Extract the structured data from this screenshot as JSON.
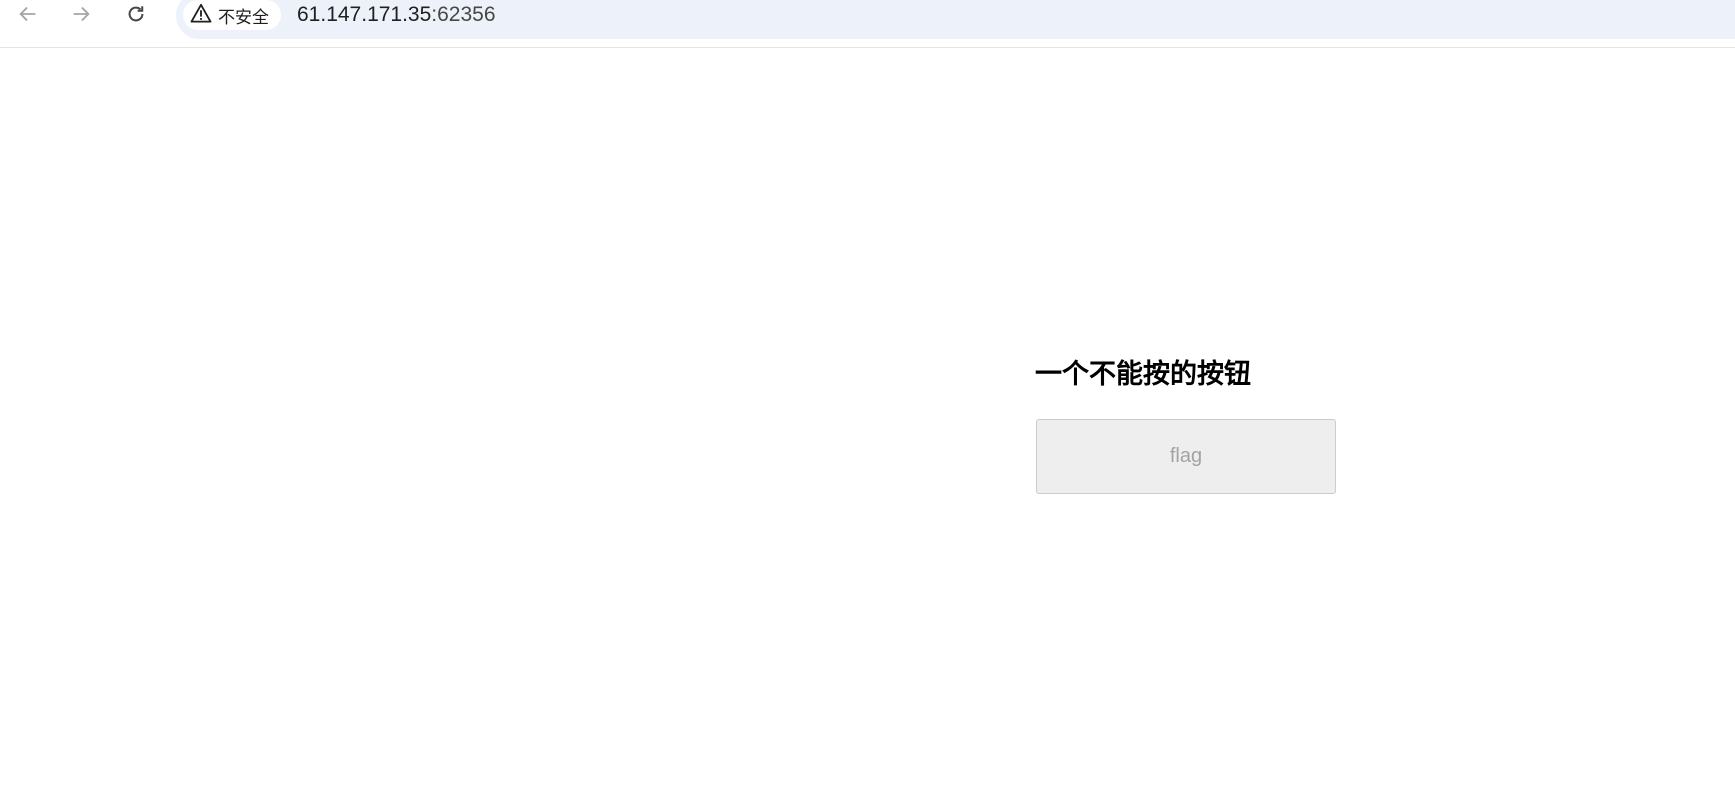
{
  "browser": {
    "security_label": "不安全",
    "url_host": "61.147.171.35",
    "url_port": ":62356",
    "icons": {
      "back": "arrow-left",
      "forward": "arrow-right",
      "reload": "reload",
      "security": "warning-triangle"
    }
  },
  "page": {
    "heading": "一个不能按的按钮",
    "button_label": "flag",
    "button_disabled": true
  }
}
